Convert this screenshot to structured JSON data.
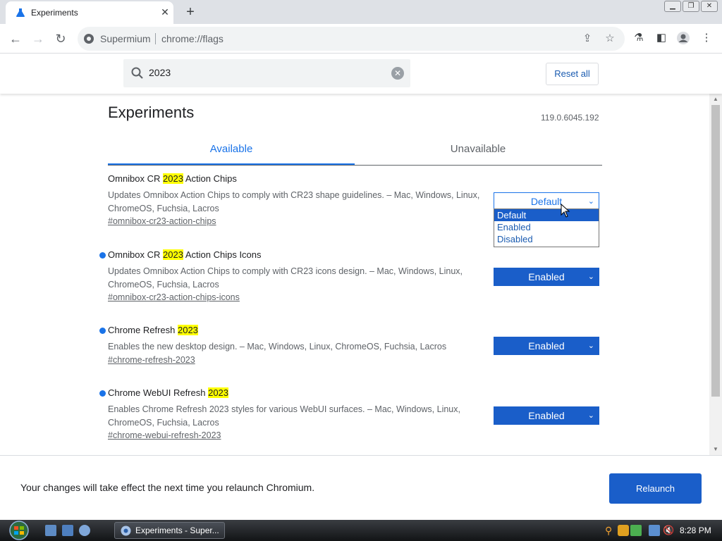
{
  "browser": {
    "tab_title": "Experiments",
    "omnibox_brand": "Supermium",
    "omnibox_url": "chrome://flags"
  },
  "flags_header": {
    "search_value": "2023",
    "reset_label": "Reset all"
  },
  "page": {
    "title": "Experiments",
    "version": "119.0.6045.192",
    "tabs": [
      {
        "label": "Available"
      },
      {
        "label": "Unavailable"
      }
    ]
  },
  "flags": [
    {
      "name_prefix": "Omnibox CR ",
      "name_highlight": "2023",
      "name_suffix": " Action Chips",
      "description": "Updates Omnibox Action Chips to comply with CR23 shape guidelines. – Mac, Windows, Linux, ChromeOS, Fuchsia, Lacros",
      "link": "#omnibox-cr23-action-chips",
      "value": "Default",
      "modified": false
    },
    {
      "name_prefix": "Omnibox CR ",
      "name_highlight": "2023",
      "name_suffix": " Action Chips Icons",
      "description": "Updates Omnibox Action Chips to comply with CR23 icons design. – Mac, Windows, Linux, ChromeOS, Fuchsia, Lacros",
      "link": "#omnibox-cr23-action-chips-icons",
      "value": "Enabled",
      "modified": true
    },
    {
      "name_prefix": "Chrome Refresh ",
      "name_highlight": "2023",
      "name_suffix": "",
      "description": "Enables the new desktop design. – Mac, Windows, Linux, ChromeOS, Fuchsia, Lacros",
      "link": "#chrome-refresh-2023",
      "value": "Enabled",
      "modified": true
    },
    {
      "name_prefix": "Chrome WebUI Refresh ",
      "name_highlight": "2023",
      "name_suffix": "",
      "description": "Enables Chrome Refresh 2023 styles for various WebUI surfaces. – Mac, Windows, Linux, ChromeOS, Fuchsia, Lacros",
      "link": "#chrome-webui-refresh-2023",
      "value": "Enabled",
      "modified": true
    }
  ],
  "dropdown": {
    "options": [
      "Default",
      "Enabled",
      "Disabled"
    ],
    "selected": "Default"
  },
  "relaunch": {
    "message": "Your changes will take effect the next time you relaunch Chromium.",
    "button_label": "Relaunch"
  },
  "taskbar": {
    "window_label": "Experiments - Super...",
    "clock": "8:28 PM"
  },
  "colors": {
    "accent": "#1a73e8",
    "enabled_select": "#1a5ec9",
    "highlight": "#ffff00"
  }
}
